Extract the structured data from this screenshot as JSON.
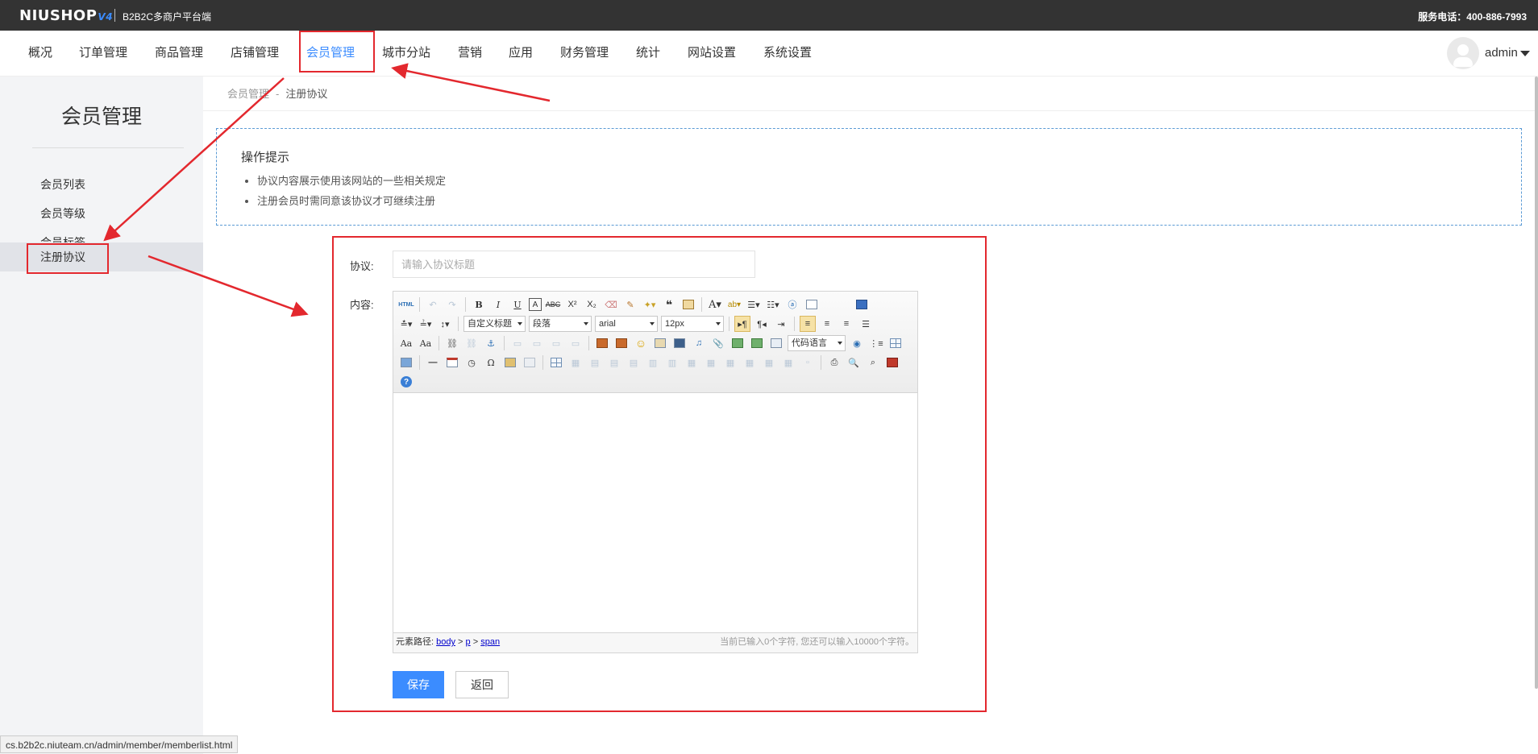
{
  "topbar": {
    "brand": "NIUSHOP",
    "brand_version": "V4",
    "subtitle": "B2B2C多商户平台端",
    "hotline": "服务电话：400-886-7993"
  },
  "nav": {
    "items": [
      {
        "label": "概况"
      },
      {
        "label": "订单管理"
      },
      {
        "label": "商品管理"
      },
      {
        "label": "店铺管理"
      },
      {
        "label": "会员管理"
      },
      {
        "label": "城市分站"
      },
      {
        "label": "营销"
      },
      {
        "label": "应用"
      },
      {
        "label": "财务管理"
      },
      {
        "label": "统计"
      },
      {
        "label": "网站设置"
      },
      {
        "label": "系统设置"
      }
    ],
    "active": "会员管理",
    "user": "admin"
  },
  "sidebar": {
    "title": "会员管理",
    "items": [
      {
        "label": "会员列表"
      },
      {
        "label": "会员等级"
      },
      {
        "label": "会员标签"
      },
      {
        "label": "注册协议"
      }
    ],
    "active": "注册协议"
  },
  "breadcrumb": {
    "parent": "会员管理",
    "separator": "-",
    "current": "注册协议"
  },
  "tips": {
    "title": "操作提示",
    "items": [
      "协议内容展示使用该网站的一些相关规定",
      "注册会员时需同意该协议才可继续注册"
    ]
  },
  "form": {
    "title_label": "协议:",
    "title_placeholder": "请输入协议标题",
    "title_value": "",
    "content_label": "内容:"
  },
  "editor": {
    "toolbar_selects": {
      "heading": "自定义标题",
      "paragraph": "段落",
      "font_family": "arial",
      "font_size": "12px",
      "code_language": "代码语言"
    },
    "status": {
      "path_label": "元素路径:",
      "path": [
        "body",
        "p",
        "span"
      ],
      "path_sep": ">",
      "count": "当前已输入0个字符, 您还可以输入10000个字符。"
    }
  },
  "buttons": {
    "save": "保存",
    "back": "返回"
  },
  "browser_status": "cs.b2b2c.niuteam.cn/admin/member/memberlist.html",
  "colors": {
    "accent": "#3b8cff",
    "topbar": "#333333",
    "annotation": "#e3282e"
  }
}
